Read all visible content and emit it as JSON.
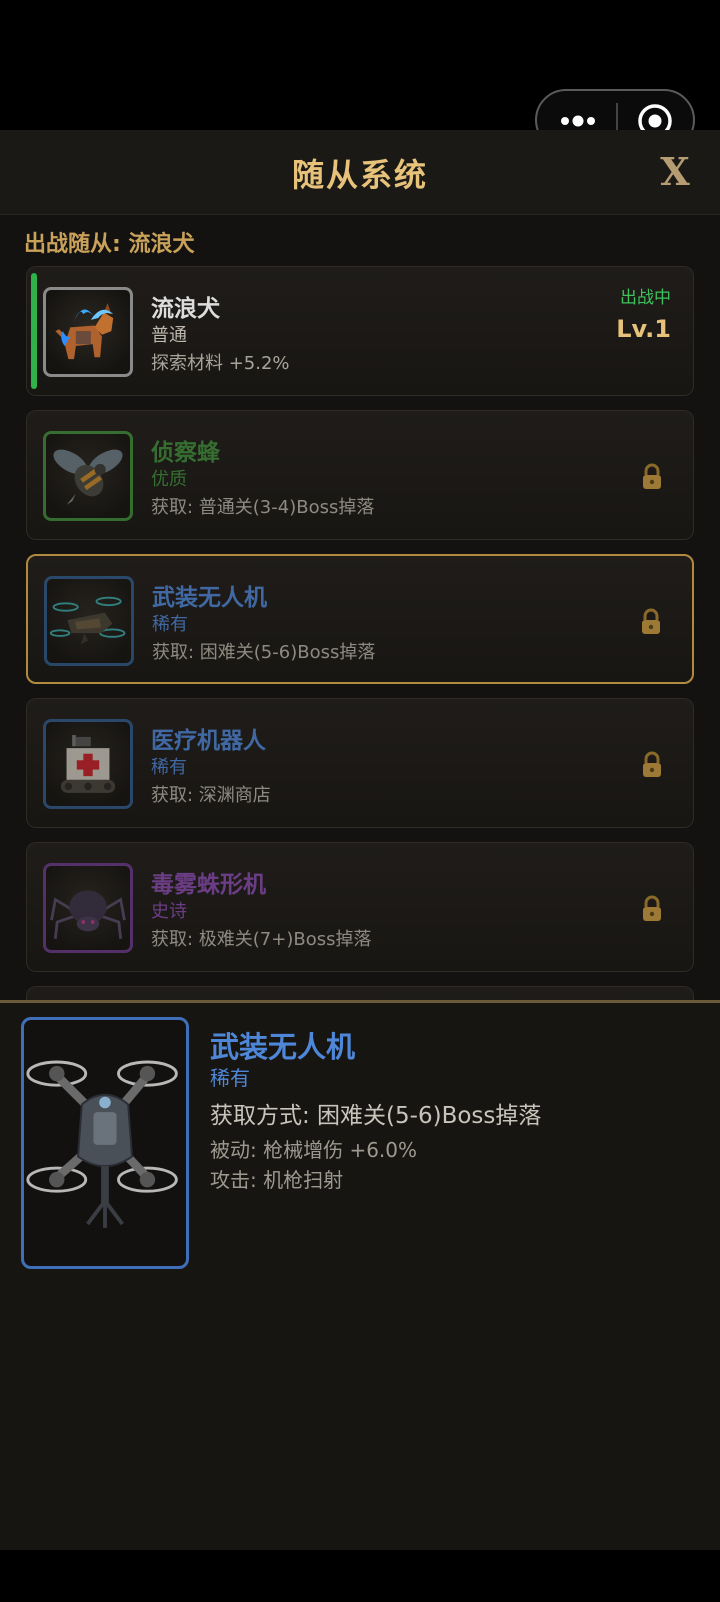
{
  "title": "随从系统",
  "close_label": "X",
  "active_label": "出战随从: 流浪犬",
  "colors": {
    "gold": "#e6c27a",
    "common": "#dddddd",
    "fine": "#3f8f3a",
    "rare": "#4f87d8",
    "epic": "#8a4bb0",
    "active_green": "#3ec25c"
  },
  "pets": [
    {
      "name": "流浪犬",
      "rarity": "普通",
      "desc": "探索材料 +5.2%",
      "status": "出战中",
      "level": "Lv.1",
      "icon": "dog-portrait"
    },
    {
      "name": "侦察蜂",
      "rarity": "优质",
      "desc": "获取: 普通关(3-4)Boss掉落",
      "icon": "bee-portrait",
      "locked": true
    },
    {
      "name": "武装无人机",
      "rarity": "稀有",
      "desc": "获取: 困难关(5-6)Boss掉落",
      "icon": "drone-portrait",
      "locked": true,
      "selected": true
    },
    {
      "name": "医疗机器人",
      "rarity": "稀有",
      "desc": "获取: 深渊商店",
      "icon": "medic-robot-portrait",
      "locked": true
    },
    {
      "name": "毒雾蛛形机",
      "rarity": "史诗",
      "desc": "获取: 极难关(7+)Boss掉落",
      "icon": "spider-portrait",
      "locked": true
    }
  ],
  "detail": {
    "name": "武装无人机",
    "rarity": "稀有",
    "source": "获取方式: 困难关(5-6)Boss掉落",
    "passive": "被动: 枪械增伤 +6.0%",
    "attack": "攻击: 机枪扫射"
  }
}
